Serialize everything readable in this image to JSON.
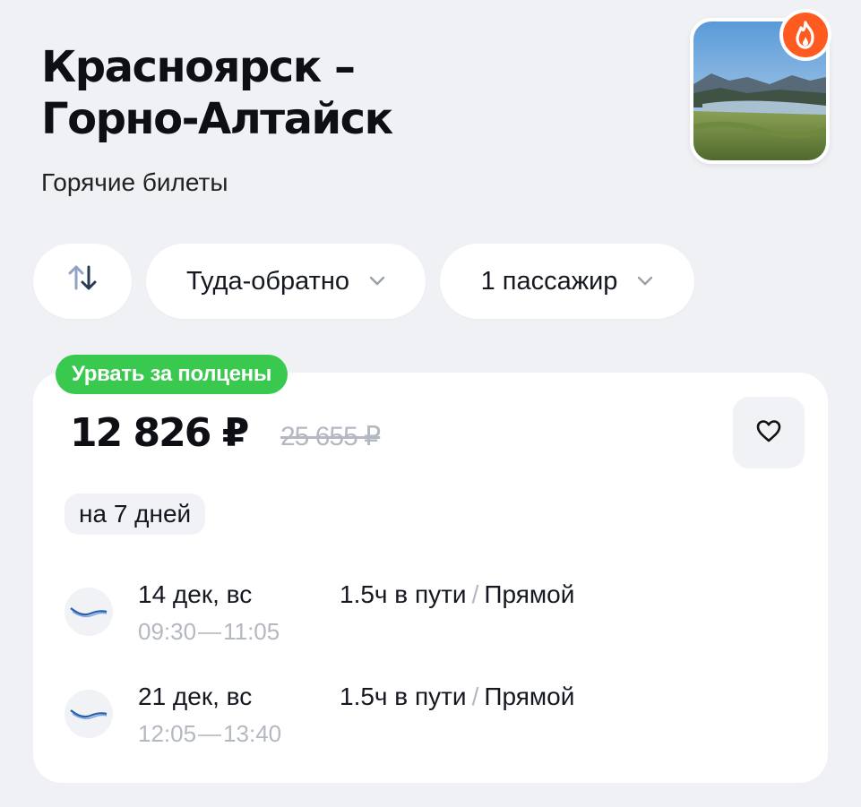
{
  "header": {
    "title_line1": "Красноярск –",
    "title_line2": "Горно-Алтайск",
    "subtitle": "Горячие билеты"
  },
  "filters": {
    "swap_icon": "swap-vertical-icon",
    "trip_type": "Туда-обратно",
    "passengers": "1 пассажир"
  },
  "offer": {
    "badge": "Урвать за полцены",
    "price": "12 826 ₽",
    "old_price": "25 655 ₽",
    "duration_days": "на 7 дней",
    "favorite_icon": "heart-icon",
    "legs": [
      {
        "date": "14 дек, вс",
        "depart": "09:30",
        "arrive": "11:05",
        "travel": "1.5ч в пути",
        "sep": "/",
        "type": "Прямой",
        "airline_icon": "airline-logo-icon"
      },
      {
        "date": "21 дек, вс",
        "depart": "12:05",
        "arrive": "13:40",
        "travel": "1.5ч в пути",
        "sep": "/",
        "type": "Прямой",
        "airline_icon": "airline-logo-icon"
      }
    ]
  },
  "colors": {
    "background": "#eff1f5",
    "deal_badge": "#3ac94f",
    "hot_badge": "#ff5a1f",
    "muted_text": "#b3b8c1"
  }
}
